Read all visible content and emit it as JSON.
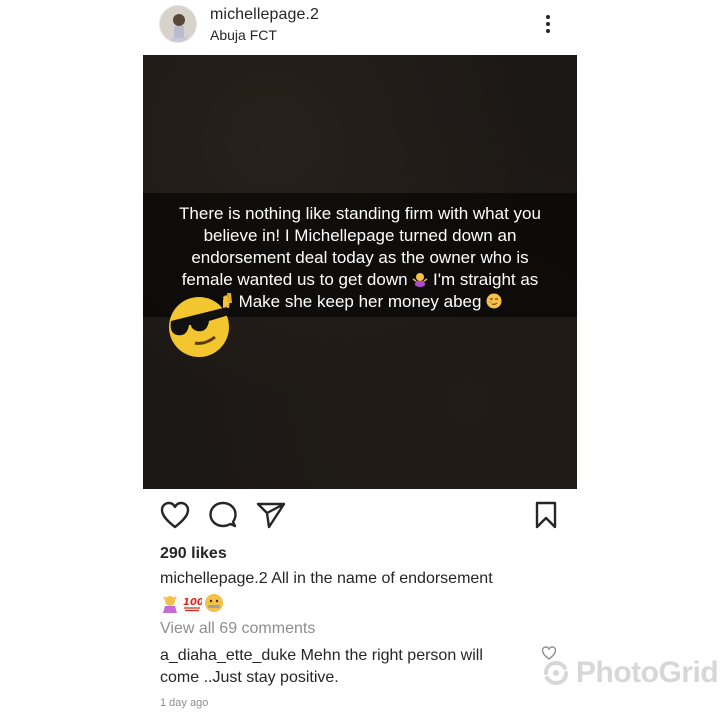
{
  "post": {
    "username": "michellepage.2",
    "location": "Abuja FCT",
    "image_caption_lines": [
      "There is nothing like standing firm with what you",
      "believe in! I Michellepage turned down an",
      "endorsement deal today as the owner who is",
      "female wanted us to get down",
      "I'm straight as",
      "Make she keep her money abeg"
    ],
    "likes": "290 likes",
    "caption_user": "michellepage.2",
    "caption_text": "All in the name of endorsement",
    "view_comments": "View all 69 comments",
    "comment_user": "a_diaha_ette_duke",
    "comment_text": "Mehn the right person will come ..Just stay positive.",
    "timestamp": "1 day ago"
  },
  "icons": {
    "more": "more-options-icon",
    "like": "heart-icon",
    "comment": "comment-icon",
    "share": "send-icon",
    "save": "bookmark-icon",
    "comment_like": "small-heart-icon"
  },
  "watermark": {
    "text": "PhotoGrid"
  },
  "colors": {
    "text": "#262626",
    "muted": "#8e8e8e",
    "post_bg": "#1c1815",
    "watermark": "#d3d3d3"
  }
}
